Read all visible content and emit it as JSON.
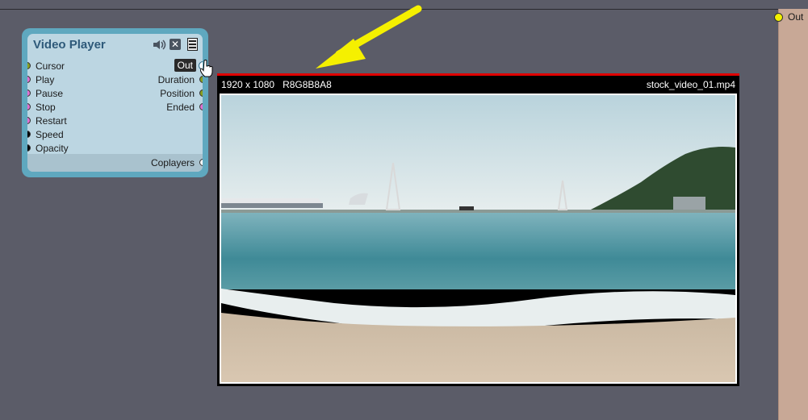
{
  "workspace": {
    "right_port_label": "Out",
    "right_port_color": "#f2f000"
  },
  "node": {
    "title": "Video Player",
    "inputs": [
      {
        "label": "Cursor",
        "color": "#8aa020"
      },
      {
        "label": "Play",
        "color": "#e070d0"
      },
      {
        "label": "Pause",
        "color": "#e070d0"
      },
      {
        "label": "Stop",
        "color": "#e070d0"
      },
      {
        "label": "Restart",
        "color": "#e070d0"
      },
      {
        "label": "Speed",
        "color": "#000000"
      },
      {
        "label": "Opacity",
        "color": "#000000"
      }
    ],
    "outputs": [
      {
        "label": "Out",
        "color": "#ffffff"
      },
      {
        "label": "Duration",
        "color": "#8aa020"
      },
      {
        "label": "Position",
        "color": "#8aa020"
      },
      {
        "label": "Ended",
        "color": "#e070d0"
      }
    ],
    "footer_output": {
      "label": "Coplayers",
      "color": "#ffffff"
    },
    "icons": [
      "speaker-icon",
      "close-icon",
      "menu-icon"
    ]
  },
  "preview": {
    "resolution": "1920 x 1080",
    "format": "R8G8B8A8",
    "filename": "stock_video_01.mp4",
    "border_color": "#e00000"
  },
  "annotation": {
    "arrow_color": "#f5f000"
  }
}
